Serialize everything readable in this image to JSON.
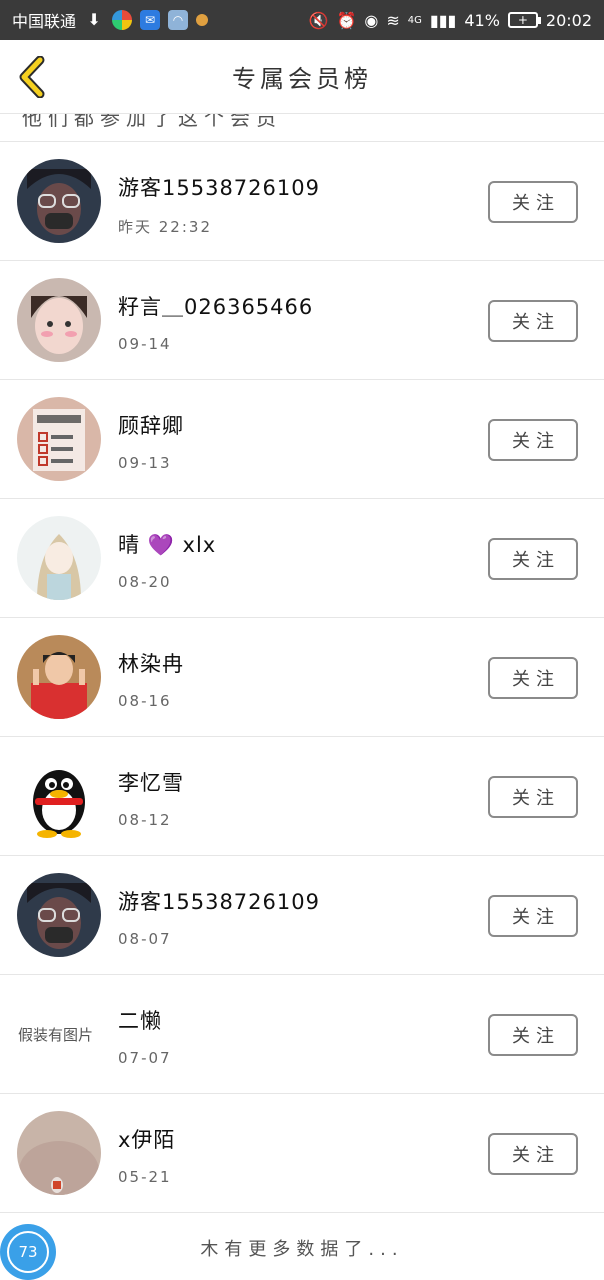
{
  "status_bar": {
    "carrier": "中国联通",
    "signal_label": "4G",
    "battery_percent": "41%",
    "time": "20:02"
  },
  "header": {
    "title": "专属会员榜"
  },
  "cutoff_text": "他们都参加了这个会员",
  "follow_label": "关注",
  "members": [
    {
      "name": "游客15538726109",
      "date": "昨天 22:32",
      "avatar": "photo"
    },
    {
      "name": "籽言＿026365466",
      "date": "09-14",
      "avatar": "photo"
    },
    {
      "name": "顾辞卿",
      "date": "09-13",
      "avatar": "photo"
    },
    {
      "name": "晴",
      "name_suffix": "xlx",
      "date": "08-20",
      "avatar": "photo"
    },
    {
      "name": "林染冉",
      "date": "08-16",
      "avatar": "photo"
    },
    {
      "name": "李忆雪",
      "date": "08-12",
      "avatar": "qq-penguin"
    },
    {
      "name": "游客15538726109",
      "date": "08-07",
      "avatar": "photo"
    },
    {
      "name": "二懒",
      "date": "07-07",
      "avatar": "placeholder",
      "placeholder_text": "假装有图片"
    },
    {
      "name": "x伊陌",
      "date": "05-21",
      "avatar": "photo"
    }
  ],
  "footer": {
    "text": "木有更多数据了...",
    "badge": "73"
  },
  "colors": {
    "status_bar_bg": "#3a3a3a",
    "back_arrow": "#f5d020",
    "badge_bg": "#3aa0e8"
  }
}
